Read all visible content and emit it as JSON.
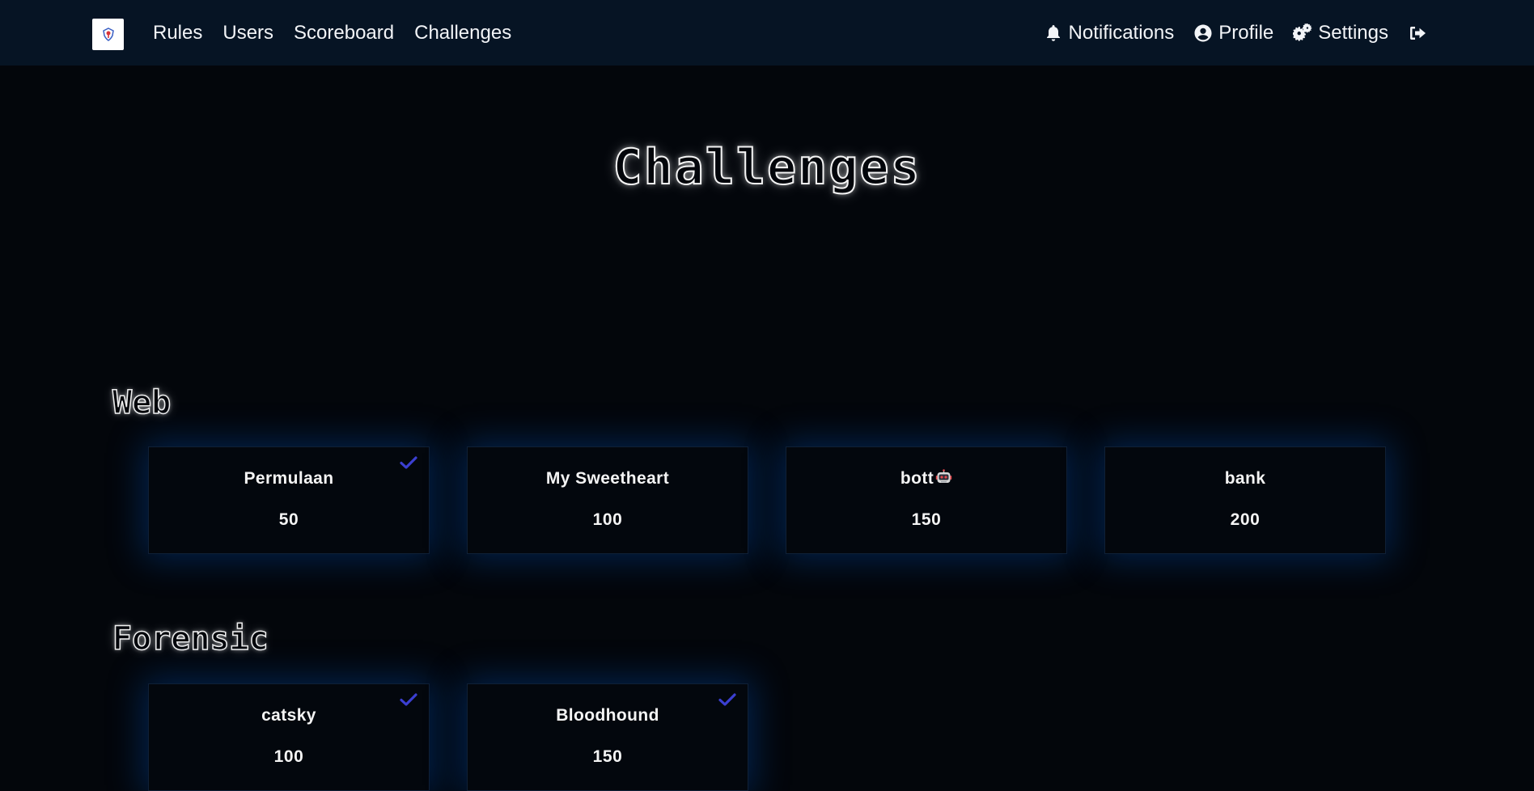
{
  "nav": {
    "logo_icon": "ctf-logo-icon",
    "left_links": [
      {
        "label": "Rules"
      },
      {
        "label": "Users"
      },
      {
        "label": "Scoreboard"
      },
      {
        "label": "Challenges"
      }
    ],
    "right_links": [
      {
        "label": "Notifications",
        "icon": "bell-icon"
      },
      {
        "label": "Profile",
        "icon": "user-circle-icon"
      },
      {
        "label": "Settings",
        "icon": "gears-icon"
      },
      {
        "label": "",
        "icon": "logout-icon"
      }
    ]
  },
  "page": {
    "title": "Challenges"
  },
  "categories": [
    {
      "name": "Web",
      "challenges": [
        {
          "name": "Permulaan",
          "value": "50",
          "solved": true
        },
        {
          "name": "My Sweetheart",
          "value": "100",
          "solved": false
        },
        {
          "name": "bott",
          "value": "150",
          "solved": false,
          "emoji": "robot-icon"
        },
        {
          "name": "bank",
          "value": "200",
          "solved": false
        }
      ]
    },
    {
      "name": "Forensic",
      "challenges": [
        {
          "name": "catsky",
          "value": "100",
          "solved": true
        },
        {
          "name": "Bloodhound",
          "value": "150",
          "solved": true
        }
      ]
    }
  ],
  "colors": {
    "background": "#03060b",
    "navbar": "#061424",
    "card_glow": "#0048a0",
    "solved_check": "#3b3fd1",
    "text": "#f4f4f4"
  }
}
